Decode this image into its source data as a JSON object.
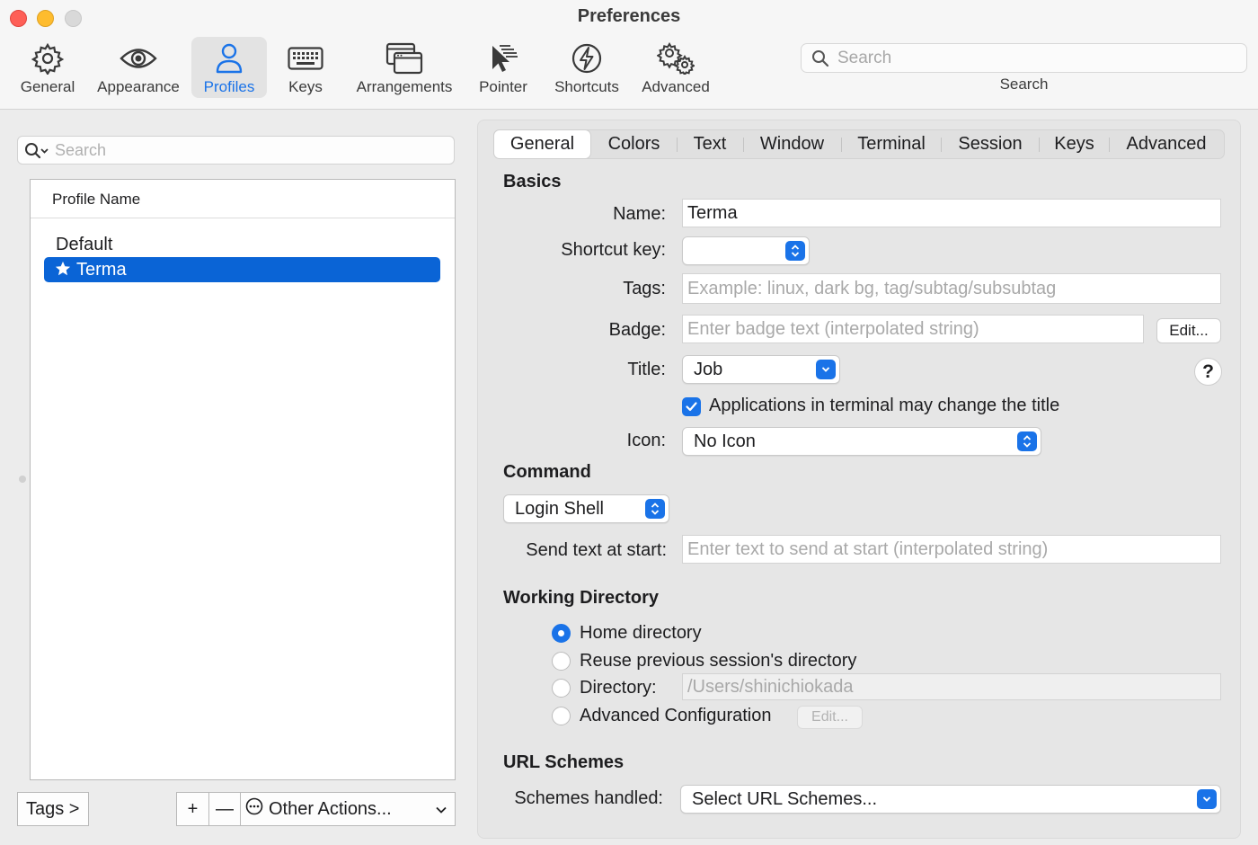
{
  "window": {
    "title": "Preferences"
  },
  "toolbar": {
    "items": [
      {
        "label": "General",
        "icon": "gear-icon"
      },
      {
        "label": "Appearance",
        "icon": "eye-icon"
      },
      {
        "label": "Profiles",
        "icon": "person-icon",
        "active": true
      },
      {
        "label": "Keys",
        "icon": "keyboard-icon"
      },
      {
        "label": "Arrangements",
        "icon": "windows-icon"
      },
      {
        "label": "Pointer",
        "icon": "cursor-icon"
      },
      {
        "label": "Shortcuts",
        "icon": "lightning-icon"
      },
      {
        "label": "Advanced",
        "icon": "gears-icon"
      }
    ],
    "search": {
      "placeholder": "Search",
      "label": "Search"
    }
  },
  "profiles": {
    "search_placeholder": "Search",
    "column_header": "Profile Name",
    "items": [
      {
        "name": "Default",
        "selected": false
      },
      {
        "name": "Terma",
        "selected": true,
        "default_star": true
      }
    ],
    "tags_button": "Tags >",
    "add_label": "+",
    "remove_label": "—",
    "other_actions": "Other Actions..."
  },
  "tabs": [
    "General",
    "Colors",
    "Text",
    "Window",
    "Terminal",
    "Session",
    "Keys",
    "Advanced"
  ],
  "active_tab": "General",
  "basics": {
    "heading": "Basics",
    "name_label": "Name:",
    "name_value": "Terma",
    "shortcut_label": "Shortcut key:",
    "shortcut_value": "",
    "tags_label": "Tags:",
    "tags_placeholder": "Example: linux, dark bg, tag/subtag/subsubtag",
    "badge_label": "Badge:",
    "badge_placeholder": "Enter badge text (interpolated string)",
    "badge_edit": "Edit...",
    "title_label": "Title:",
    "title_value": "Job",
    "help": "?",
    "title_checkbox": "Applications in terminal may change the title",
    "title_checkbox_checked": true,
    "icon_label": "Icon:",
    "icon_value": "No Icon"
  },
  "command": {
    "heading": "Command",
    "mode": "Login Shell",
    "send_text_label": "Send text at start:",
    "send_text_placeholder": "Enter text to send at start (interpolated string)"
  },
  "working_directory": {
    "heading": "Working Directory",
    "options": [
      {
        "label": "Home directory",
        "selected": true
      },
      {
        "label": "Reuse previous session's directory",
        "selected": false
      },
      {
        "label": "Directory:",
        "selected": false
      },
      {
        "label": "Advanced Configuration",
        "selected": false
      }
    ],
    "directory_value": "/Users/shinichiokada",
    "advanced_edit": "Edit..."
  },
  "url_schemes": {
    "heading": "URL Schemes",
    "label": "Schemes handled:",
    "value": "Select URL Schemes..."
  },
  "colors": {
    "accent": "#1a73e8",
    "selection": "#0a64d6"
  }
}
